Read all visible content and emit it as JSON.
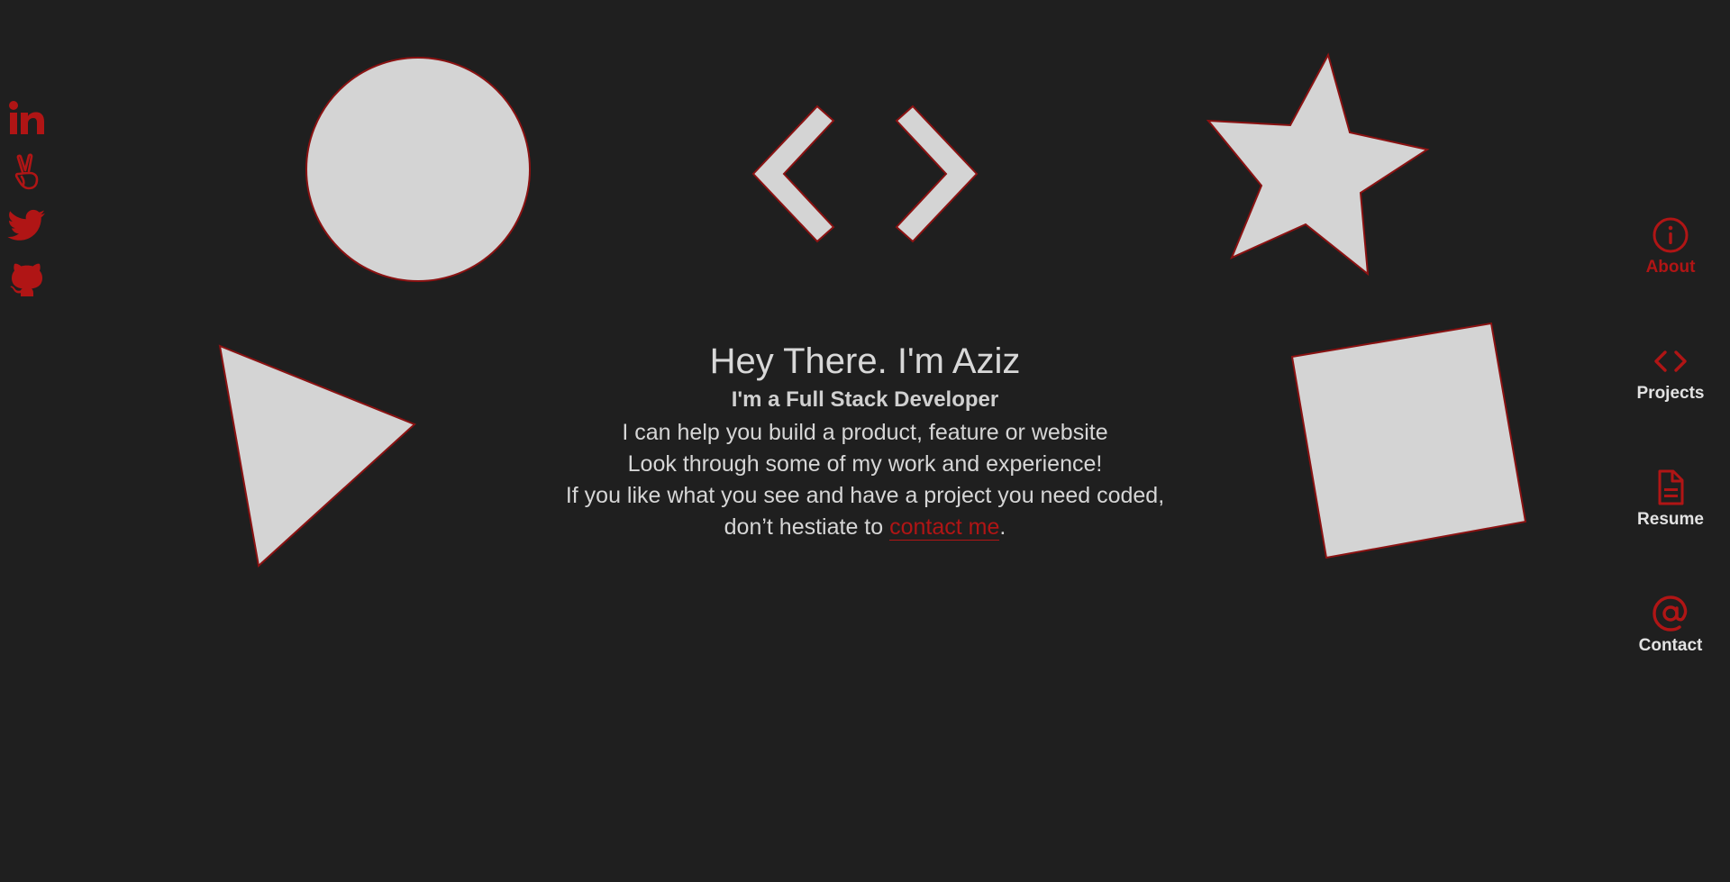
{
  "colors": {
    "background": "#1f1f1f",
    "accent": "#b01515",
    "shape_fill": "#d4d4d4",
    "text": "#d6d6d6"
  },
  "social": [
    {
      "icon": "linkedin-icon"
    },
    {
      "icon": "angellist-icon"
    },
    {
      "icon": "twitter-icon"
    },
    {
      "icon": "github-icon"
    }
  ],
  "hero": {
    "title": "Hey There. I'm Aziz",
    "subtitle": "I'm a Full Stack Developer",
    "line1": "I can help you build a product, feature or website",
    "line2": "Look through some of my work and experience!",
    "line3": "If you like what you see and have a project you need coded,",
    "line4_prefix": "don’t hestiate to ",
    "line4_link": "contact me",
    "line4_suffix": "."
  },
  "nav": {
    "items": [
      {
        "label": "About",
        "icon": "info-icon",
        "active": true
      },
      {
        "label": "Projects",
        "icon": "code-icon",
        "active": false
      },
      {
        "label": "Resume",
        "icon": "document-icon",
        "active": false
      },
      {
        "label": "Contact",
        "icon": "at-icon",
        "active": false
      }
    ]
  }
}
